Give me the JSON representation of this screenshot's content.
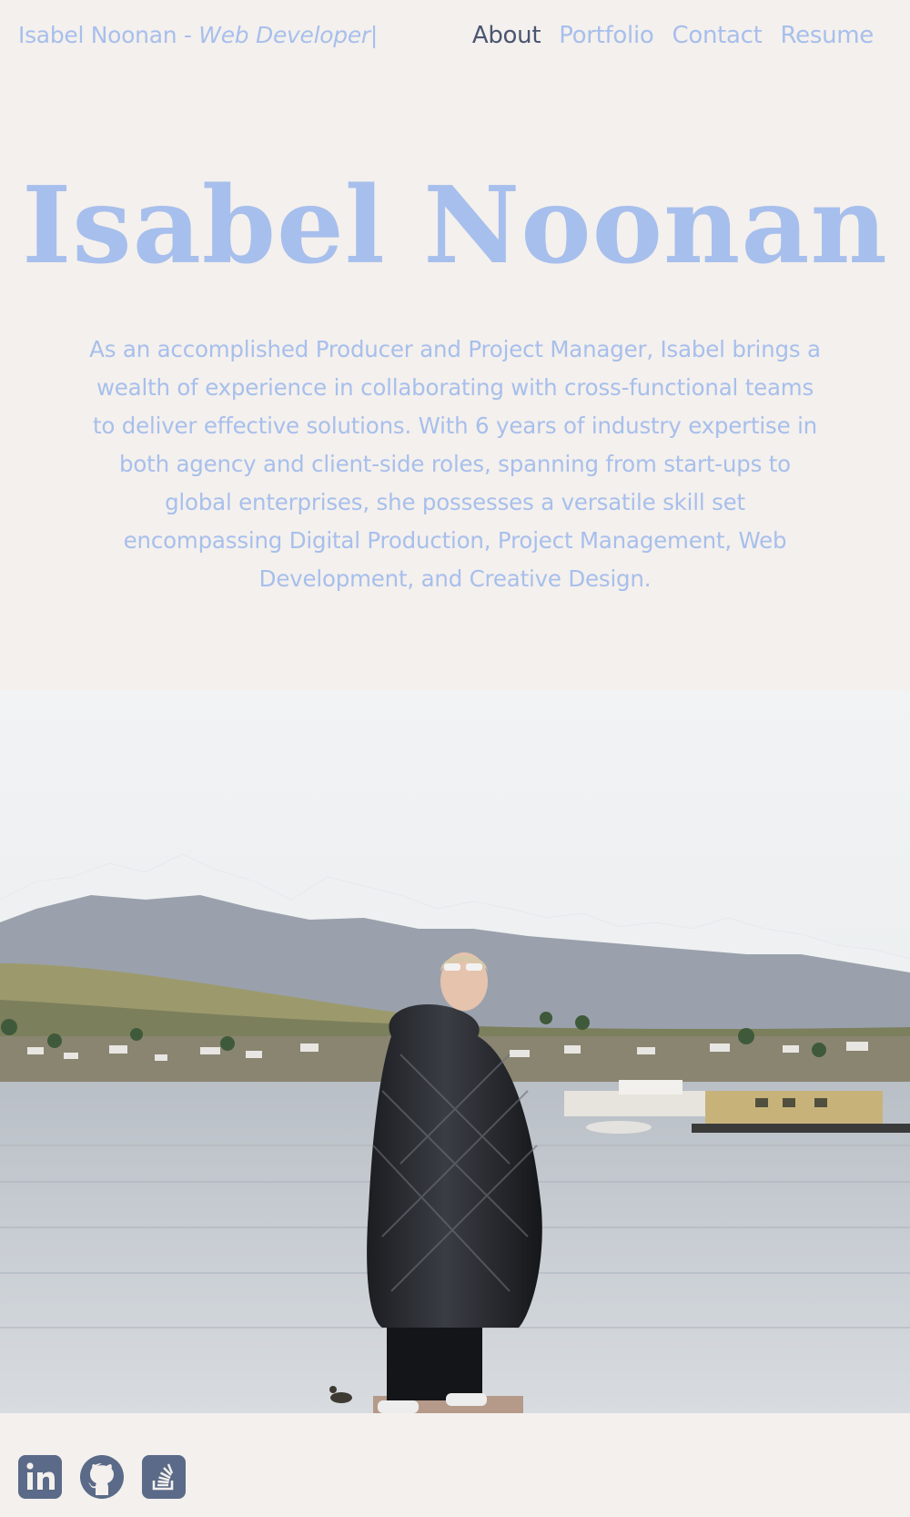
{
  "header": {
    "brand_name": "Isabel Noonan - ",
    "brand_role": "Web Developer|",
    "nav": [
      {
        "label": "About",
        "active": true
      },
      {
        "label": "Portfolio",
        "active": false
      },
      {
        "label": "Contact",
        "active": false
      },
      {
        "label": "Resume",
        "active": false
      }
    ]
  },
  "hero": {
    "title": "Isabel Noonan",
    "bio": "As an accomplished Producer and Project Manager, Isabel brings a wealth of experience in collaborating with cross-functional teams to deliver effective solutions. With 6 years of industry expertise in both agency and client-side roles, spanning from start-ups to global enterprises, she possesses a versatile skill set encompassing Digital Production, Project Management, Web Development, and Creative Design."
  },
  "photo": {
    "alt": "Isabel standing by a lake in front of snowy mountains"
  },
  "social": [
    {
      "icon": "linkedin-icon",
      "label": "LinkedIn"
    },
    {
      "icon": "github-icon",
      "label": "GitHub"
    },
    {
      "icon": "stackoverflow-icon",
      "label": "Stack Overflow"
    }
  ],
  "colors": {
    "background": "#f4f0ed",
    "accent": "#a7bfec",
    "active_nav": "#4a5670",
    "icon": "#5a6a88"
  }
}
